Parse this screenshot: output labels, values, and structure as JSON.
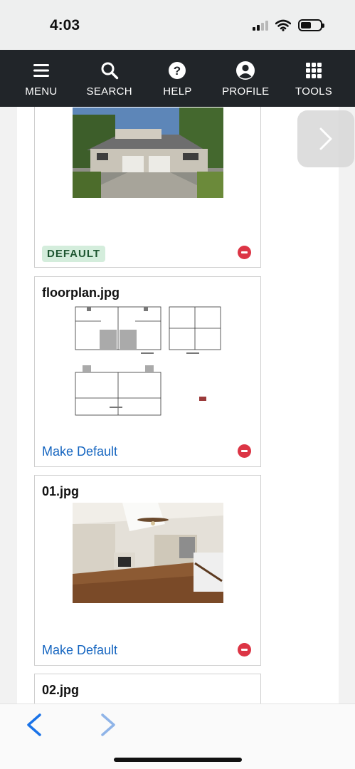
{
  "status_bar": {
    "time": "4:03"
  },
  "navbar": {
    "items": [
      {
        "label": "MENU",
        "icon": "menu-icon"
      },
      {
        "label": "SEARCH",
        "icon": "search-icon"
      },
      {
        "label": "HELP",
        "icon": "help-icon"
      },
      {
        "label": "PROFILE",
        "icon": "profile-icon"
      },
      {
        "label": "TOOLS",
        "icon": "grid-icon"
      }
    ]
  },
  "photos": [
    {
      "filename": "",
      "badge": "DEFAULT",
      "image": "house-exterior-photo"
    },
    {
      "filename": "floorplan.jpg",
      "action": "Make Default",
      "image": "floorplan-drawing"
    },
    {
      "filename": "01.jpg",
      "action": "Make Default",
      "image": "living-room-photo"
    },
    {
      "filename": "02.jpg"
    }
  ],
  "colors": {
    "navbar": "#212529",
    "link": "#1565c0",
    "remove": "#dc3545",
    "badge_bg": "#d4eddc",
    "badge_text": "#1e5631"
  }
}
